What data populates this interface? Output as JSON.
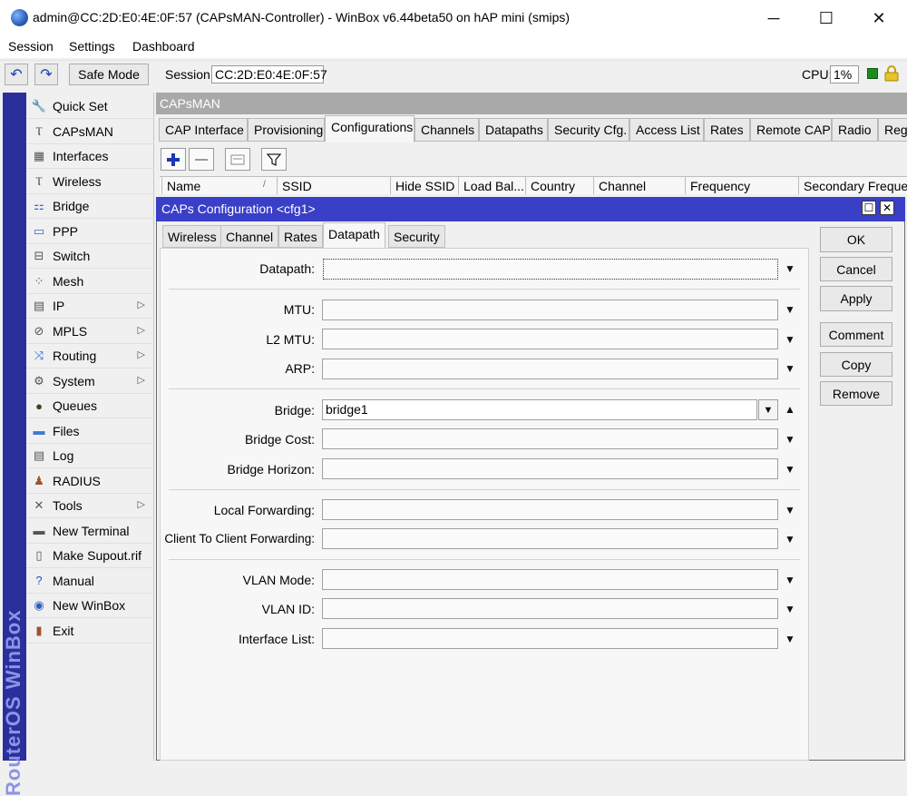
{
  "window": {
    "title": "admin@CC:2D:E0:4E:0F:57 (CAPsMAN-Controller) - WinBox v6.44beta50 on hAP mini (smips)",
    "minimize": "─",
    "maximize": "☐",
    "close": "✕"
  },
  "menu": [
    "Session",
    "Settings",
    "Dashboard"
  ],
  "toolbar": {
    "undo_icon": "↶",
    "redo_icon": "↷",
    "safe_mode": "Safe Mode",
    "session_label": "Session:",
    "session_value": "CC:2D:E0:4E:0F:57",
    "cpu_label": "CPU:",
    "cpu_value": "1%"
  },
  "sidebar": {
    "brand": "RouterOS WinBox",
    "items": [
      {
        "label": "Quick Set",
        "icon": "quickset-icon",
        "arrow": ""
      },
      {
        "label": "CAPsMAN",
        "icon": "antenna-icon",
        "arrow": ""
      },
      {
        "label": "Interfaces",
        "icon": "interfaces-icon",
        "arrow": ""
      },
      {
        "label": "Wireless",
        "icon": "wireless-icon",
        "arrow": ""
      },
      {
        "label": "Bridge",
        "icon": "bridge-icon",
        "arrow": ""
      },
      {
        "label": "PPP",
        "icon": "ppp-icon",
        "arrow": ""
      },
      {
        "label": "Switch",
        "icon": "switch-icon",
        "arrow": ""
      },
      {
        "label": "Mesh",
        "icon": "mesh-icon",
        "arrow": ""
      },
      {
        "label": "IP",
        "icon": "ip-icon",
        "arrow": "▷"
      },
      {
        "label": "MPLS",
        "icon": "mpls-icon",
        "arrow": "▷"
      },
      {
        "label": "Routing",
        "icon": "routing-icon",
        "arrow": "▷"
      },
      {
        "label": "System",
        "icon": "system-icon",
        "arrow": "▷"
      },
      {
        "label": "Queues",
        "icon": "queues-icon",
        "arrow": ""
      },
      {
        "label": "Files",
        "icon": "files-icon",
        "arrow": ""
      },
      {
        "label": "Log",
        "icon": "log-icon",
        "arrow": ""
      },
      {
        "label": "RADIUS",
        "icon": "radius-icon",
        "arrow": ""
      },
      {
        "label": "Tools",
        "icon": "tools-icon",
        "arrow": "▷"
      },
      {
        "label": "New Terminal",
        "icon": "terminal-icon",
        "arrow": ""
      },
      {
        "label": "Make Supout.rif",
        "icon": "supout-icon",
        "arrow": ""
      },
      {
        "label": "Manual",
        "icon": "manual-icon",
        "arrow": ""
      },
      {
        "label": "New WinBox",
        "icon": "winbox-icon",
        "arrow": ""
      },
      {
        "label": "Exit",
        "icon": "exit-icon",
        "arrow": ""
      }
    ]
  },
  "capsman": {
    "title": "CAPsMAN",
    "tabs": [
      "CAP Interface",
      "Provisioning",
      "Configurations",
      "Channels",
      "Datapaths",
      "Security Cfg.",
      "Access List",
      "Rates",
      "Remote CAP",
      "Radio",
      "Reg"
    ],
    "active_tab": "Configurations",
    "columns": [
      "Name",
      "SSID",
      "Hide SSID",
      "Load Bal...",
      "Country",
      "Channel",
      "Frequency",
      "Secondary Freque..."
    ],
    "sort_indicator": "/"
  },
  "dialog": {
    "title": "CAPs Configuration <cfg1>",
    "tabs": [
      "Wireless",
      "Channel",
      "Rates",
      "Datapath",
      "Security"
    ],
    "active_tab": "Datapath",
    "fields": {
      "datapath": {
        "label": "Datapath:",
        "value": ""
      },
      "mtu": {
        "label": "MTU:",
        "value": ""
      },
      "l2mtu": {
        "label": "L2 MTU:",
        "value": ""
      },
      "arp": {
        "label": "ARP:",
        "value": ""
      },
      "bridge": {
        "label": "Bridge:",
        "value": "bridge1"
      },
      "bridge_cost": {
        "label": "Bridge Cost:",
        "value": ""
      },
      "bridge_horizon": {
        "label": "Bridge Horizon:",
        "value": ""
      },
      "local_forwarding": {
        "label": "Local Forwarding:",
        "value": ""
      },
      "client_forwarding": {
        "label": "Client To Client Forwarding:",
        "value": ""
      },
      "vlan_mode": {
        "label": "VLAN Mode:",
        "value": ""
      },
      "vlan_id": {
        "label": "VLAN ID:",
        "value": ""
      },
      "interface_list": {
        "label": "Interface List:",
        "value": ""
      }
    },
    "buttons": [
      "OK",
      "Cancel",
      "Apply",
      "Comment",
      "Copy",
      "Remove"
    ]
  },
  "colors": {
    "dialog_title": "#3a3fc8",
    "sidebar_strip": "#2a2f9b",
    "capsman_title": "#a9a9a9",
    "cpu_indicator": "#1f8a1f"
  }
}
